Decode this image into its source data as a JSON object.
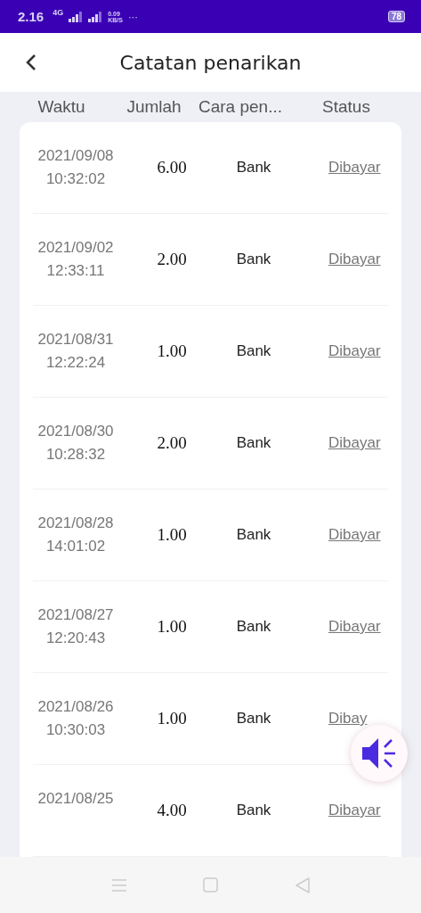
{
  "status_bar": {
    "time": "2.16",
    "network": "4G",
    "speed": "0.09",
    "speed_unit": "KB/S",
    "more": "···",
    "battery": "78"
  },
  "header": {
    "title": "Catatan penarikan"
  },
  "table": {
    "columns": [
      "Waktu",
      "Jumlah",
      "Cara pen...",
      "Status"
    ],
    "rows": [
      {
        "date": "2021/09/08",
        "time": "10:32:02",
        "amount": "6.00",
        "method": "Bank",
        "status": "Dibayar"
      },
      {
        "date": "2021/09/02",
        "time": "12:33:11",
        "amount": "2.00",
        "method": "Bank",
        "status": "Dibayar"
      },
      {
        "date": "2021/08/31",
        "time": "12:22:24",
        "amount": "1.00",
        "method": "Bank",
        "status": "Dibayar"
      },
      {
        "date": "2021/08/30",
        "time": "10:28:32",
        "amount": "2.00",
        "method": "Bank",
        "status": "Dibayar"
      },
      {
        "date": "2021/08/28",
        "time": "14:01:02",
        "amount": "1.00",
        "method": "Bank",
        "status": "Dibayar"
      },
      {
        "date": "2021/08/27",
        "time": "12:20:43",
        "amount": "1.00",
        "method": "Bank",
        "status": "Dibayar"
      },
      {
        "date": "2021/08/26",
        "time": "10:30:03",
        "amount": "1.00",
        "method": "Bank",
        "status": "Dibay"
      },
      {
        "date": "2021/08/25",
        "amount": "4.00",
        "method": "Bank",
        "status": "Dibayar"
      }
    ]
  }
}
